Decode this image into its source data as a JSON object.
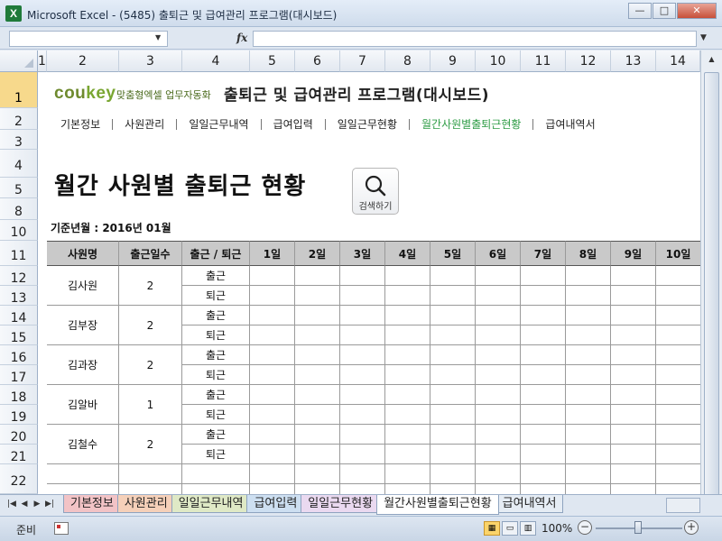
{
  "window": {
    "title": "Microsoft Excel - (5485) 출퇴근 및 급여관리 프로그램(대시보드)",
    "logo_letter": "X",
    "buttons": [
      "minimize",
      "maximize",
      "close"
    ]
  },
  "formula_bar": {
    "name_box": "",
    "fx_label": "fx",
    "formula": ""
  },
  "grid": {
    "columns": [
      "1",
      "2",
      "3",
      "4",
      "5",
      "6",
      "7",
      "8",
      "9",
      "10",
      "11",
      "12",
      "13",
      "14"
    ],
    "rows": [
      "1",
      "2",
      "3",
      "4",
      "5",
      "8",
      "10",
      "11",
      "12",
      "13",
      "14",
      "15",
      "16",
      "17",
      "18",
      "19",
      "20",
      "21",
      "22"
    ],
    "selected_row": "1"
  },
  "sheet": {
    "brand_main": "cou",
    "brand_key": "key",
    "brand_sub": "맞춤형엑셀 업무자동화",
    "app_title": "출퇴근 및 급여관리 프로그램(대시보드)",
    "nav": [
      "기본정보",
      "사원관리",
      "일일근무내역",
      "급여입력",
      "일일근무현황",
      "월간사원별출퇴근현황",
      "급여내역서"
    ],
    "nav_active": 5,
    "title": "월간 사원별 출퇴근 현황",
    "search_label": "검색하기",
    "base_date": "기준년월 : 2016년 01월"
  },
  "table": {
    "headers": [
      "사원명",
      "출근일수",
      "출근 / 퇴근",
      "1일",
      "2일",
      "3일",
      "4일",
      "5일",
      "6일",
      "7일",
      "8일",
      "9일",
      "10일"
    ],
    "employees": [
      {
        "name": "김사원",
        "days": "2",
        "in": "출근",
        "out": "퇴근"
      },
      {
        "name": "김부장",
        "days": "2",
        "in": "출근",
        "out": "퇴근"
      },
      {
        "name": "김과장",
        "days": "2",
        "in": "출근",
        "out": "퇴근"
      },
      {
        "name": "김알바",
        "days": "1",
        "in": "출근",
        "out": "퇴근"
      },
      {
        "name": "김철수",
        "days": "2",
        "in": "출근",
        "out": "퇴근"
      }
    ]
  },
  "sheet_tabs": [
    "기본정보",
    "사원관리",
    "일일근무내역",
    "급여입력",
    "일일근무현황",
    "월간사원별출퇴근현황",
    "급여내역서"
  ],
  "active_tab": 5,
  "status": {
    "ready": "준비",
    "zoom": "100%"
  },
  "colors": {
    "accent_green": "#2e9c45",
    "brand_green": "#79a631",
    "header_gray": "#c9c9c9",
    "row_highlight": "#f7d98c"
  }
}
